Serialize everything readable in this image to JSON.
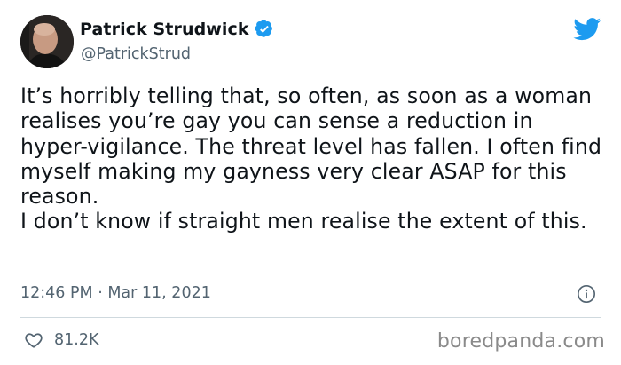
{
  "author": {
    "name": "Patrick Strudwick",
    "handle": "@PatrickStrud",
    "verified": true
  },
  "tweet": {
    "paragraph_1": "It’s horribly telling that, so often, as soon as a woman realises you’re gay you can sense a reduction in hyper-vigilance. The threat level has fallen. I often find myself making my gayness very clear ASAP for this reason.",
    "paragraph_2": "I don’t know if straight men realise the extent of this."
  },
  "meta": {
    "timestamp": "12:46 PM · Mar 11, 2021"
  },
  "engagement": {
    "likes": "81.2K"
  },
  "watermark": "boredpanda.com",
  "colors": {
    "twitter_blue": "#1d9bf0",
    "text": "#0f1419",
    "secondary": "#536471",
    "divider": "#cfd9de"
  },
  "icons": [
    "verified-badge-icon",
    "twitter-bird-icon",
    "info-icon",
    "heart-icon"
  ]
}
